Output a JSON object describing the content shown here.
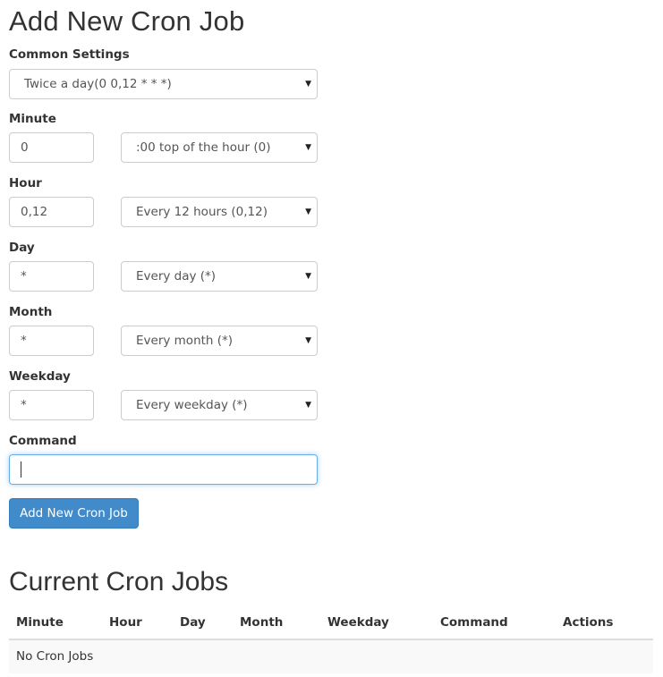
{
  "add_form": {
    "title": "Add New Cron Job",
    "common_settings": {
      "label": "Common Settings",
      "selected": "Twice a day(0 0,12 * * *)"
    },
    "fields": [
      {
        "label": "Minute",
        "value": "0",
        "select": ":00 top of the hour (0)"
      },
      {
        "label": "Hour",
        "value": "0,12",
        "select": "Every 12 hours (0,12)"
      },
      {
        "label": "Day",
        "value": "*",
        "select": "Every day (*)"
      },
      {
        "label": "Month",
        "value": "*",
        "select": "Every month (*)"
      },
      {
        "label": "Weekday",
        "value": "*",
        "select": "Every weekday (*)"
      }
    ],
    "command": {
      "label": "Command",
      "value": ""
    },
    "submit_label": "Add New Cron Job",
    "caret_glyph": "▼"
  },
  "current_jobs": {
    "title": "Current Cron Jobs",
    "columns": [
      "Minute",
      "Hour",
      "Day",
      "Month",
      "Weekday",
      "Command",
      "Actions"
    ],
    "empty_message": "No Cron Jobs"
  },
  "colors": {
    "primary": "#428bca",
    "focus_border": "#66afe9",
    "row_background": "#f9f9f9"
  }
}
